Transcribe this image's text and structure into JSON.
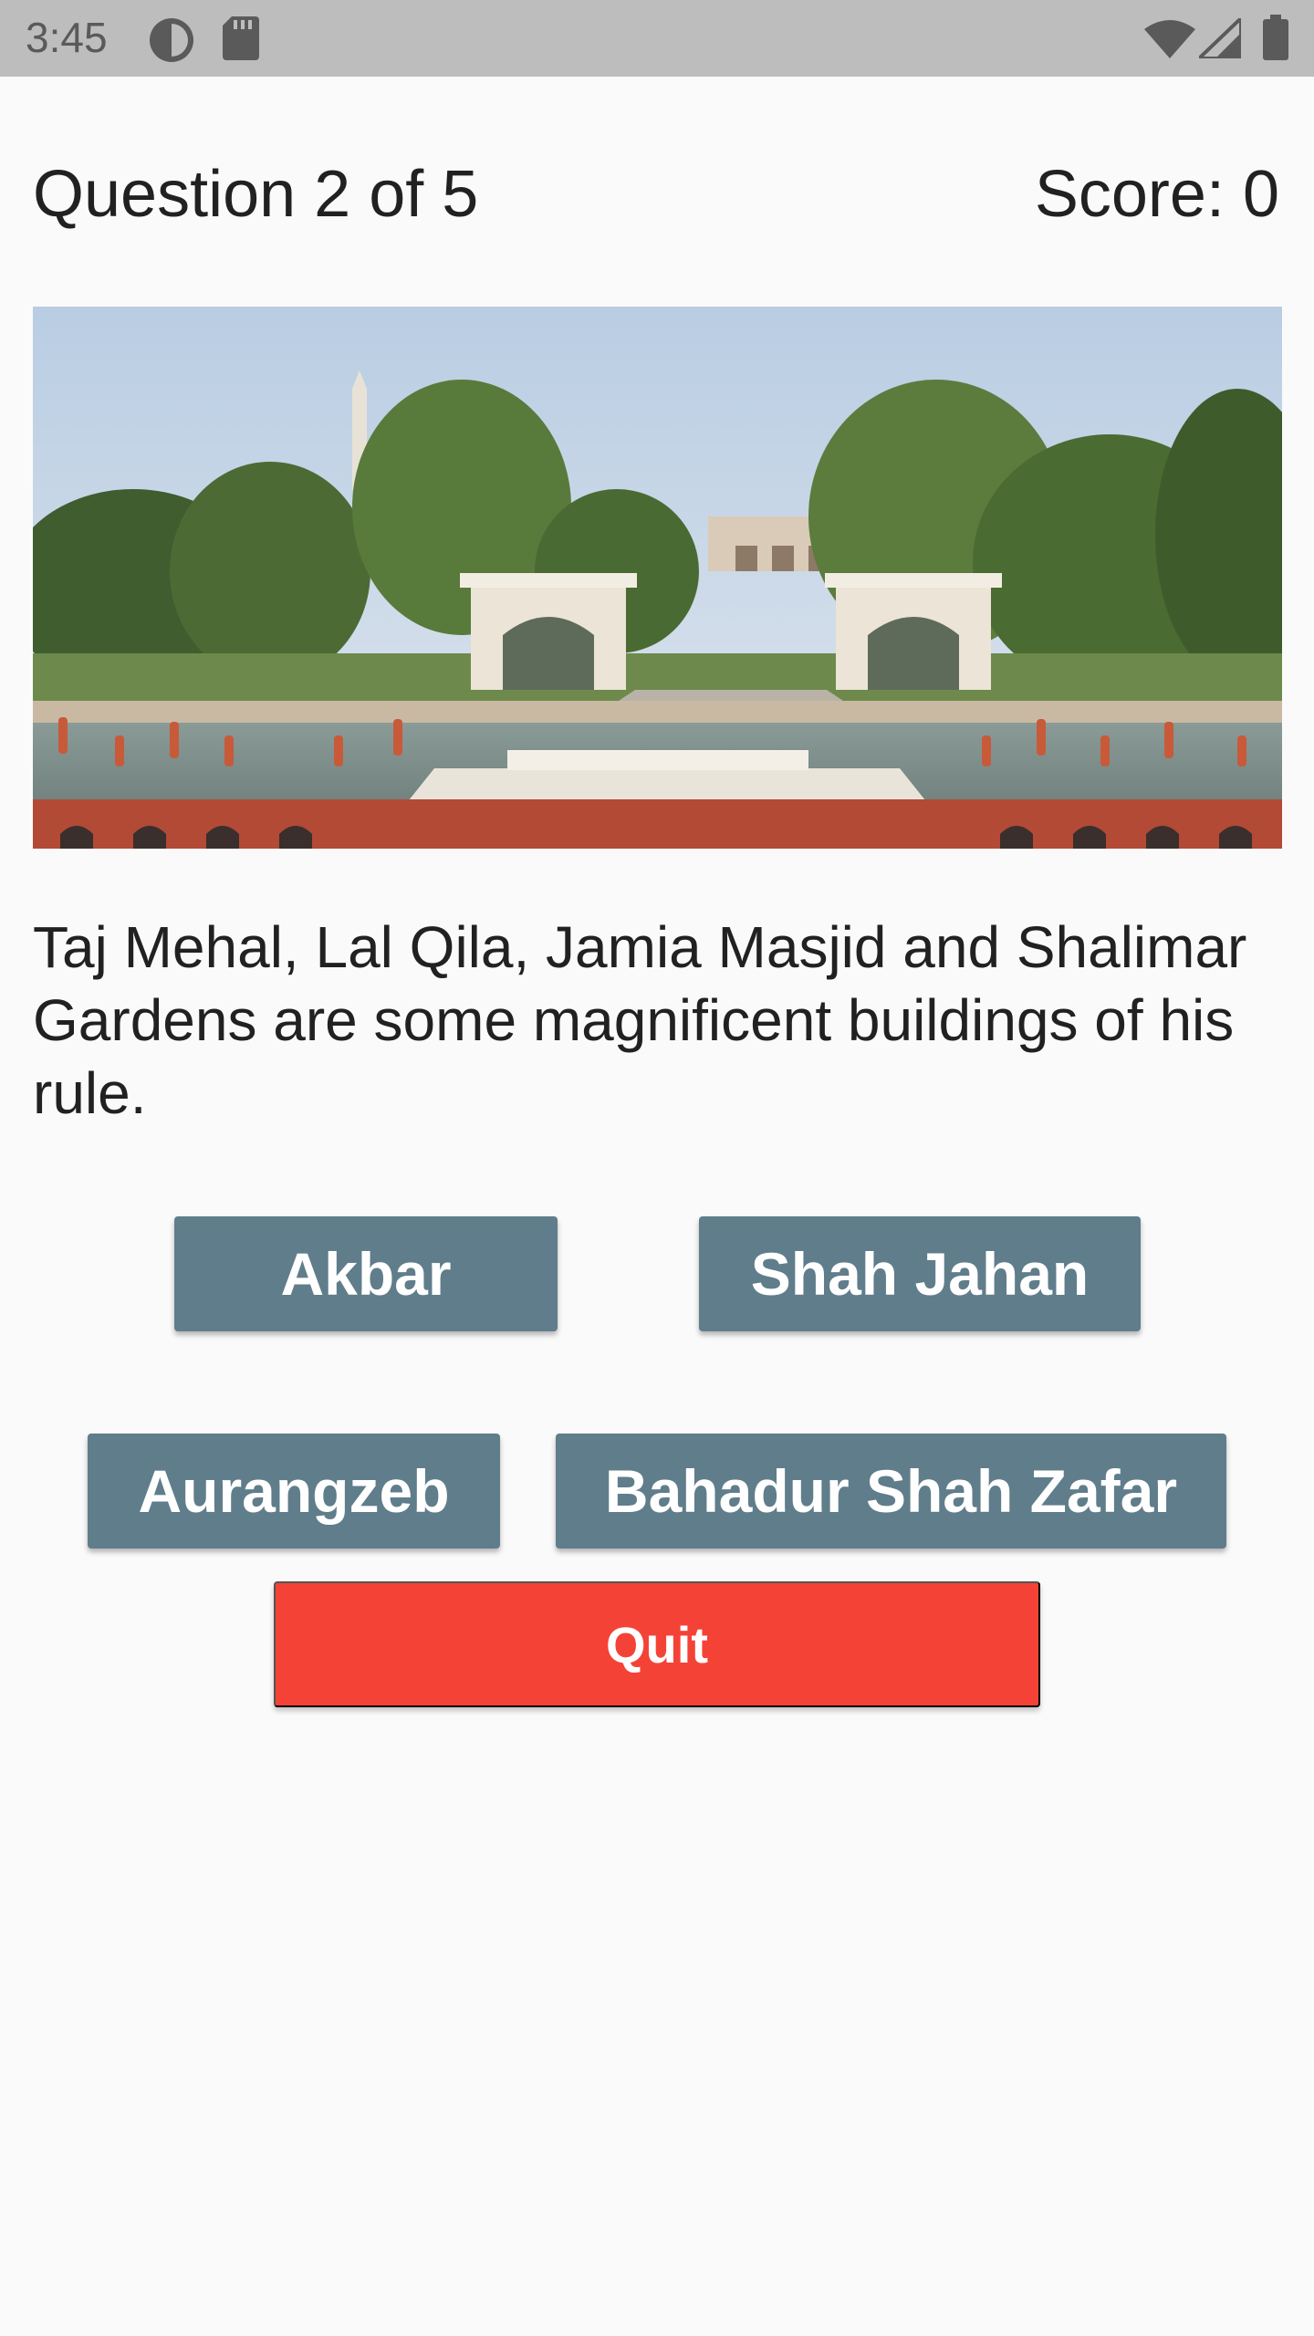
{
  "status_bar": {
    "time": "3:45",
    "icons": [
      "data-saver-icon",
      "sd-card-icon",
      "wifi-icon",
      "signal-icon",
      "battery-icon"
    ]
  },
  "header": {
    "question_counter": "Question 2 of 5",
    "score": "Score: 0"
  },
  "image": {
    "subject": "shalimar-gardens-photo"
  },
  "question": {
    "text": "Taj Mehal, Lal Qila, Jamia Masjid and Shalimar Gardens are some magnificent buildings of his rule."
  },
  "options": [
    {
      "label": "Akbar"
    },
    {
      "label": "Shah Jahan"
    },
    {
      "label": "Aurangzeb"
    },
    {
      "label": "Bahadur Shah Zafar"
    }
  ],
  "quit": {
    "label": "Quit"
  },
  "colors": {
    "option_button": "#607d8b",
    "quit_button": "#f44336",
    "status_bar": "#bdbdbd",
    "background": "#fafafa"
  }
}
